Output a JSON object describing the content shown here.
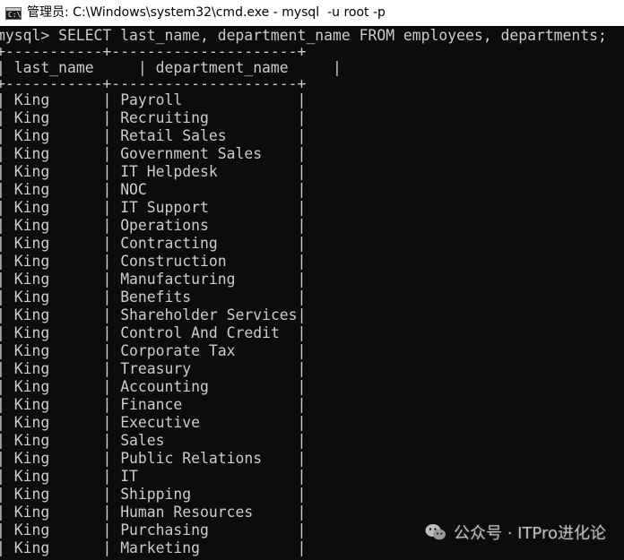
{
  "window": {
    "title": "管理员: C:\\Windows\\system32\\cmd.exe - mysql  -u root -p",
    "icon": "cmd-icon",
    "icon_text": "C:\\"
  },
  "console": {
    "command_line": "mysql> SELECT last_name, department_name FROM employees, departments;",
    "border_top": "+-----------+---------------------+",
    "border_mid": "+-----------+---------------------+",
    "headers": [
      "last_name",
      "department_name"
    ],
    "rows": [
      [
        "King",
        "Payroll"
      ],
      [
        "King",
        "Recruiting"
      ],
      [
        "King",
        "Retail Sales"
      ],
      [
        "King",
        "Government Sales"
      ],
      [
        "King",
        "IT Helpdesk"
      ],
      [
        "King",
        "NOC"
      ],
      [
        "King",
        "IT Support"
      ],
      [
        "King",
        "Operations"
      ],
      [
        "King",
        "Contracting"
      ],
      [
        "King",
        "Construction"
      ],
      [
        "King",
        "Manufacturing"
      ],
      [
        "King",
        "Benefits"
      ],
      [
        "King",
        "Shareholder Services"
      ],
      [
        "King",
        "Control And Credit"
      ],
      [
        "King",
        "Corporate Tax"
      ],
      [
        "King",
        "Treasury"
      ],
      [
        "King",
        "Accounting"
      ],
      [
        "King",
        "Finance"
      ],
      [
        "King",
        "Executive"
      ],
      [
        "King",
        "Sales"
      ],
      [
        "King",
        "Public Relations"
      ],
      [
        "King",
        "IT"
      ],
      [
        "King",
        "Shipping"
      ],
      [
        "King",
        "Human Resources"
      ],
      [
        "King",
        "Purchasing"
      ],
      [
        "King",
        "Marketing"
      ]
    ]
  },
  "watermark": {
    "text": "公众号 · ITPro进化论",
    "icon": "wechat-icon"
  },
  "colors": {
    "background": "#0c0c0c",
    "text": "#cccccc",
    "titlebar": "#ffffff"
  }
}
